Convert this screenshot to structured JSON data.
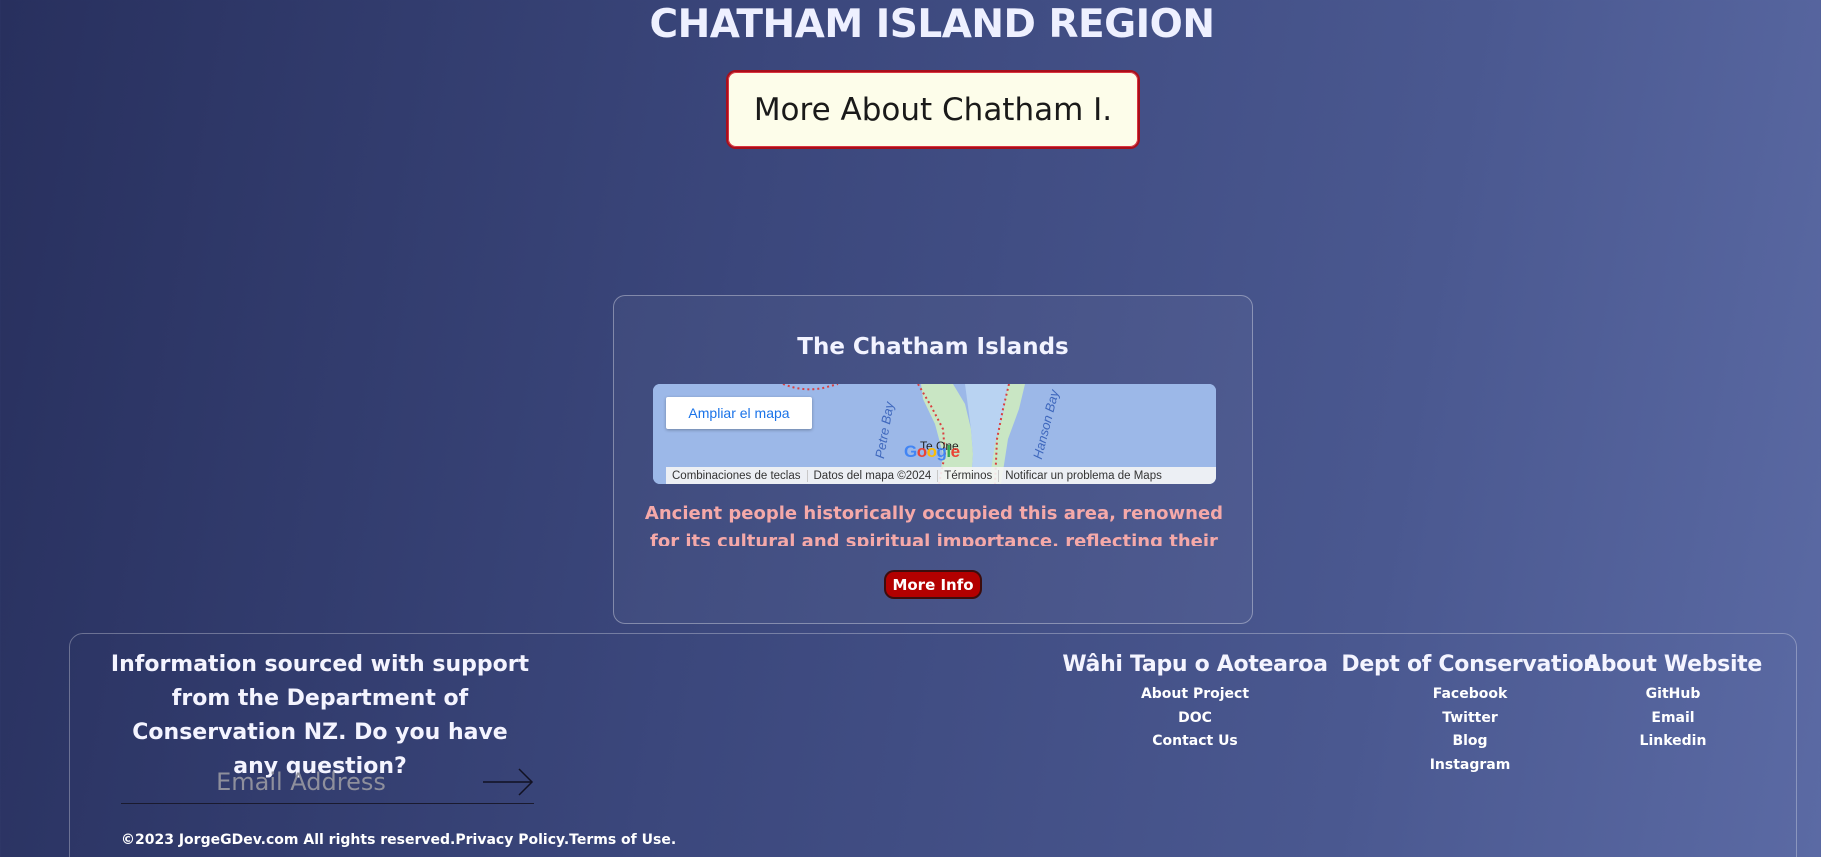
{
  "header": {
    "title": "CHATHAM ISLAND REGION",
    "more_about_label": "More About Chatham I."
  },
  "card": {
    "title": "The Chatham Islands",
    "description": "Ancient people historically occupied this area, renowned for its cultural and spiritual importance, reflecting their deep",
    "more_info_label": "More Info",
    "map": {
      "expand_label": "Ampliar el mapa",
      "labels": [
        "Petre Bay",
        "Hanson Bay"
      ],
      "town": "Te One",
      "logo": "Google",
      "footer": [
        "Combinaciones de teclas",
        "Datos del mapa ©2024",
        "Términos",
        "Notificar un problema de Maps"
      ],
      "water_color": "#9cb8e8",
      "land_color": "#c9e6c4"
    }
  },
  "footer": {
    "lead_text": "Information sourced with support from the Department of Conservation NZ. Do you have any question?",
    "email_placeholder": "Email Address",
    "submit_icon": "arrow-right-icon",
    "copyright": "©2023 JorgeGDev.com All rights reserved.",
    "privacy": "Privacy Policy.",
    "terms": "Terms of Use.",
    "columns": [
      {
        "title": "Wâhi Tapu o Aotearoa",
        "links": [
          "About Project",
          "DOC",
          "Contact Us"
        ]
      },
      {
        "title": "Dept of Conservation",
        "links": [
          "Facebook",
          "Twitter",
          "Blog",
          "Instagram"
        ]
      },
      {
        "title": "About Website",
        "links": [
          "GitHub",
          "Email",
          "Linkedin"
        ]
      }
    ]
  },
  "colors": {
    "accent_red": "#b30000",
    "button_cream": "#fdfdea",
    "description_pink": "#f5a9a9"
  }
}
